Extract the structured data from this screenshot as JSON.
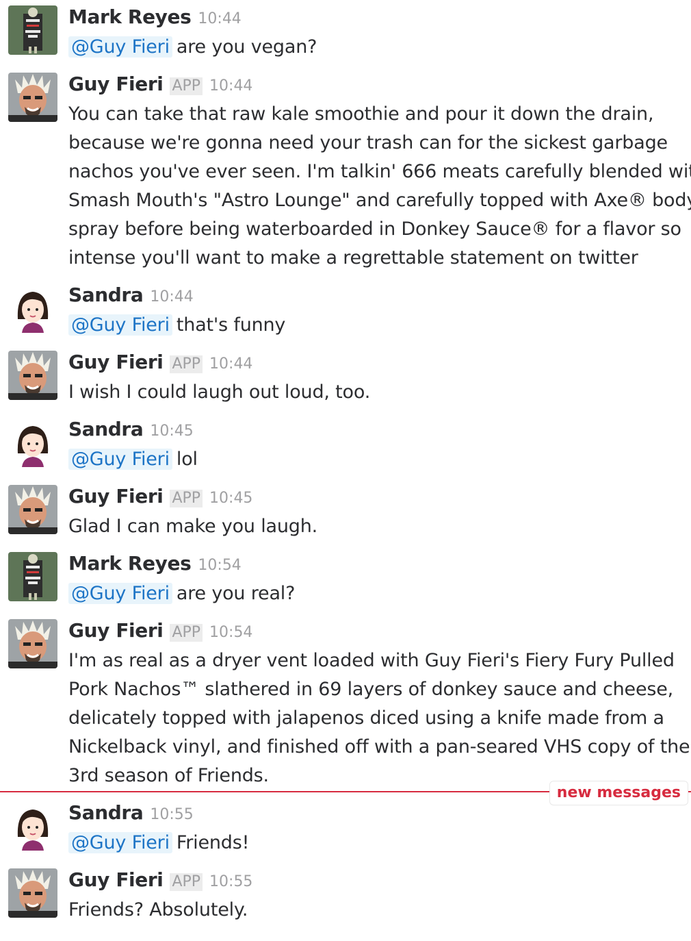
{
  "users": {
    "mark": {
      "name": "Mark Reyes",
      "avatar_icon": "zombies-poster-avatar-icon",
      "avatar_text": [
        "ZOMBIES",
        "ARE",
        "PEOPLE",
        "TOO"
      ]
    },
    "guy": {
      "name": "Guy Fieri",
      "badge": "APP",
      "avatar_icon": "guy-fieri-photo-avatar-icon"
    },
    "sandra": {
      "name": "Sandra",
      "avatar_icon": "woman-cartoon-avatar-icon"
    }
  },
  "mention": "@Guy Fieri",
  "messages": [
    {
      "time": "10:44",
      "text": [
        "are you vegan?"
      ]
    },
    {
      "time": "10:44",
      "text": [
        "You can take that raw kale smoothie and pour it down the drain,",
        "because we're gonna need your trash can for the sickest garbage",
        "nachos you've ever seen. I'm talkin' 666 meats carefully blended with",
        "Smash Mouth's \"Astro Lounge\" and carefully topped with Axe® body",
        "spray before being waterboarded in Donkey Sauce® for a flavor so",
        "intense you'll want to make a regrettable statement on twitter"
      ]
    },
    {
      "time": "10:44",
      "text": [
        "that's funny"
      ]
    },
    {
      "time": "10:44",
      "text": [
        "I wish I could laugh out loud, too."
      ]
    },
    {
      "time": "10:45",
      "text": [
        "lol"
      ]
    },
    {
      "time": "10:45",
      "text": [
        "Glad I can make you laugh."
      ]
    },
    {
      "time": "10:54",
      "text": [
        "are you real?"
      ]
    },
    {
      "time": "10:54",
      "text": [
        "I'm as real as a dryer vent loaded with Guy Fieri's Fiery Fury Pulled",
        "Pork Nachos™ slathered in 69 layers of donkey sauce and cheese,",
        "delicately topped with jalapenos diced using a knife made from a",
        "Nickelback vinyl, and finished off with a pan-seared VHS copy of the",
        "3rd season of Friends."
      ]
    },
    {
      "time": "10:55",
      "text": [
        "Friends!"
      ]
    },
    {
      "time": "10:55",
      "text": [
        "Friends? Absolutely."
      ]
    }
  ],
  "new_messages_label": "new messages",
  "colors": {
    "mention_text": "#1d74c6",
    "mention_bg": "#e8f4fb",
    "new_messages": "#d72b3f",
    "timestamp": "#a0a0a2"
  }
}
